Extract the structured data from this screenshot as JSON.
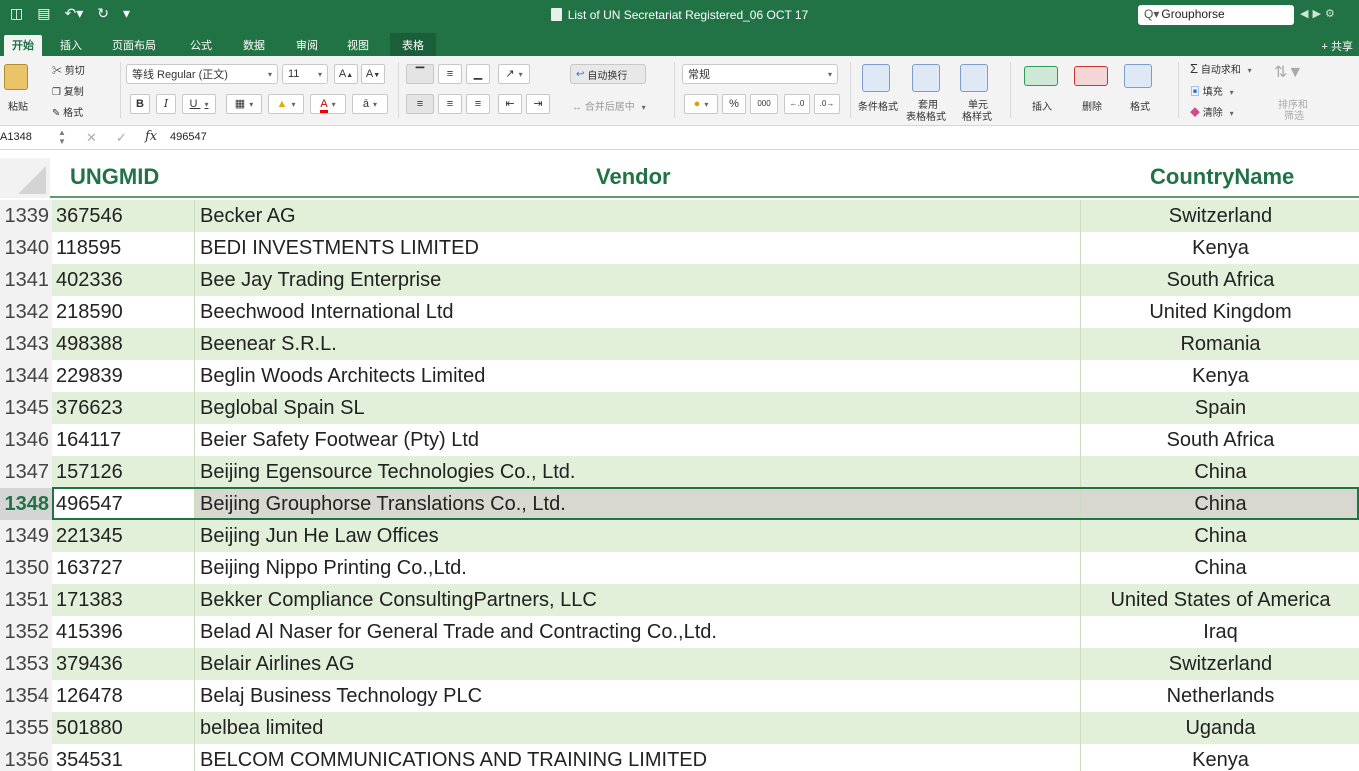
{
  "window": {
    "title": "List of UN Secretariat Registered_06 OCT 17",
    "search_value": "Grouphorse",
    "search_icon": "magnifier-icon",
    "quick_icons": [
      "sidebar-icon",
      "save-icon",
      "undo-icon",
      "redo-icon",
      "customize-icon"
    ]
  },
  "tabs": [
    {
      "label": "开始"
    },
    {
      "label": "插入"
    },
    {
      "label": "页面布局"
    },
    {
      "label": "公式"
    },
    {
      "label": "数据"
    },
    {
      "label": "审阅"
    },
    {
      "label": "视图"
    },
    {
      "label": "表格"
    }
  ],
  "share_label": "共享",
  "ribbon": {
    "paste_label": "粘贴",
    "cut_label": "剪切",
    "copy_label": "复制",
    "format_painter_label": "格式",
    "font_name": "等线 Regular (正文)",
    "font_size": "11",
    "grow_font": "A",
    "shrink_font": "A",
    "bold": "B",
    "italic": "I",
    "underline": "U",
    "wrap_text_label": "自动换行",
    "merge_center_label": "合并后居中",
    "number_format": "常规",
    "percent": "%",
    "thousands": "000",
    "conditional_format_label": "条件格式",
    "table_format_label_1": "套用",
    "table_format_label_2": "表格格式",
    "cell_style_label_1": "单元",
    "cell_style_label_2": "格样式",
    "insert_label": "插入",
    "delete_label": "删除",
    "format_label": "格式",
    "autosum_label": "自动求和",
    "fill_label": "填充",
    "clear_label": "清除",
    "sort_filter_label_1": "排序和",
    "sort_filter_label_2": "筛选",
    "accent_color": "#217346"
  },
  "formula_bar": {
    "name_box": "A1348",
    "fx_label": "fx",
    "value": "496547"
  },
  "columns": [
    "UNGMID",
    "Vendor",
    "CountryName"
  ],
  "rows": [
    {
      "rownum": "1339",
      "id": "367546",
      "vendor": "Becker AG",
      "country": "Switzerland"
    },
    {
      "rownum": "1340",
      "id": "118595",
      "vendor": "BEDI INVESTMENTS LIMITED",
      "country": "Kenya"
    },
    {
      "rownum": "1341",
      "id": "402336",
      "vendor": "Bee Jay Trading Enterprise",
      "country": "South Africa"
    },
    {
      "rownum": "1342",
      "id": "218590",
      "vendor": "Beechwood International Ltd",
      "country": "United Kingdom"
    },
    {
      "rownum": "1343",
      "id": "498388",
      "vendor": "Beenear S.R.L.",
      "country": "Romania"
    },
    {
      "rownum": "1344",
      "id": "229839",
      "vendor": "Beglin Woods Architects Limited",
      "country": "Kenya"
    },
    {
      "rownum": "1345",
      "id": "376623",
      "vendor": "Beglobal Spain SL",
      "country": "Spain"
    },
    {
      "rownum": "1346",
      "id": "164117",
      "vendor": "Beier Safety Footwear (Pty) Ltd",
      "country": "South Africa"
    },
    {
      "rownum": "1347",
      "id": "157126",
      "vendor": "Beijing Egensource Technologies Co., Ltd.",
      "country": "China"
    },
    {
      "rownum": "1348",
      "id": "496547",
      "vendor": "Beijing Grouphorse Translations Co., Ltd.",
      "country": "China",
      "selected": true
    },
    {
      "rownum": "1349",
      "id": "221345",
      "vendor": "Beijing Jun He Law Offices",
      "country": "China"
    },
    {
      "rownum": "1350",
      "id": "163727",
      "vendor": "Beijing Nippo Printing Co.,Ltd.",
      "country": "China"
    },
    {
      "rownum": "1351",
      "id": "171383",
      "vendor": "Bekker Compliance ConsultingPartners, LLC",
      "country": "United States of America"
    },
    {
      "rownum": "1352",
      "id": "415396",
      "vendor": "Belad Al Naser for General Trade and Contracting Co.,Ltd.",
      "country": "Iraq"
    },
    {
      "rownum": "1353",
      "id": "379436",
      "vendor": "Belair Airlines AG",
      "country": "Switzerland"
    },
    {
      "rownum": "1354",
      "id": "126478",
      "vendor": "Belaj Business Technology PLC",
      "country": "Netherlands"
    },
    {
      "rownum": "1355",
      "id": "501880",
      "vendor": "belbea limited",
      "country": "Uganda"
    },
    {
      "rownum": "1356",
      "id": "354531",
      "vendor": "BELCOM COMMUNICATIONS AND TRAINING LIMITED",
      "country": "Kenya"
    }
  ]
}
